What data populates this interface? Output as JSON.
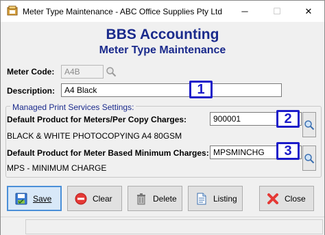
{
  "window": {
    "title": "Meter Type Maintenance - ABC Office Supplies Pty Ltd",
    "minimize_glyph": "─",
    "maximize_glyph": "☐",
    "close_glyph": "✕"
  },
  "header": {
    "title": "BBS Accounting",
    "subtitle": "Meter Type Maintenance"
  },
  "form": {
    "meter_code_label": "Meter Code:",
    "meter_code_value": "A4B",
    "description_label": "Description:",
    "description_value": "A4 Black"
  },
  "group": {
    "legend": "Managed Print Services Settings:",
    "per_copy_label": "Default Product for Meters/Per Copy Charges:",
    "per_copy_value": "900001",
    "per_copy_description": "BLACK & WHITE PHOTOCOPYING A4 80GSM",
    "minimum_label": "Default Product for Meter Based Minimum Charges:",
    "minimum_value": "MPSMINCHG",
    "minimum_description": "MPS - MINIMUM CHARGE"
  },
  "callouts": [
    "1",
    "2",
    "3"
  ],
  "buttons": {
    "save": "Save",
    "clear": "Clear",
    "delete": "Delete",
    "listing": "Listing",
    "close": "Close"
  },
  "icons": {
    "app": "app-icon",
    "lookup": "magnifier-icon",
    "save": "save-icon",
    "clear": "no-entry-icon",
    "delete": "bin-icon",
    "listing": "document-icon",
    "close": "red-x-icon"
  },
  "colors": {
    "heading": "#1a2a8c",
    "callout": "#1c1cc9",
    "primary_border": "#4a8fd8"
  }
}
